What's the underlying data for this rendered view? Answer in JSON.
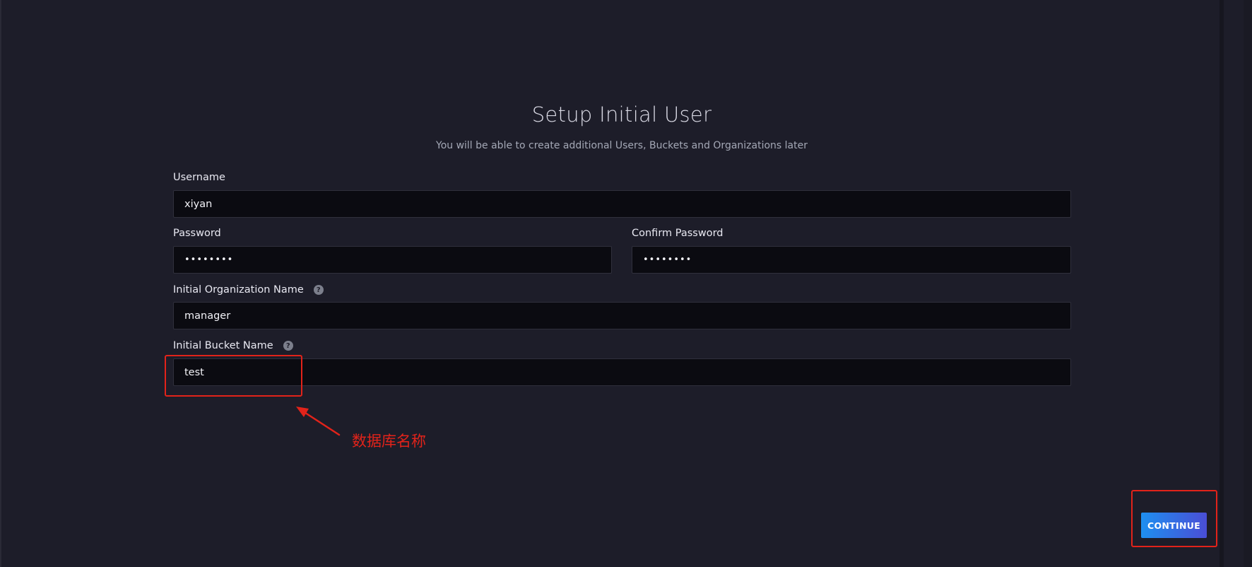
{
  "header": {
    "title": "Setup Initial User",
    "subtitle": "You will be able to create additional Users, Buckets and Organizations later"
  },
  "form": {
    "username": {
      "label": "Username",
      "value": "xiyan"
    },
    "password": {
      "label": "Password",
      "value": "••••••••"
    },
    "confirm_password": {
      "label": "Confirm Password",
      "value": "••••••••"
    },
    "org": {
      "label": "Initial Organization Name",
      "value": "manager",
      "help_icon": "question-icon"
    },
    "bucket": {
      "label": "Initial Bucket Name",
      "value": "test",
      "help_icon": "question-icon"
    }
  },
  "actions": {
    "continue_label": "CONTINUE"
  },
  "annotation": {
    "text": "数据库名称",
    "color": "#e2231a"
  },
  "colors": {
    "background": "#1d1d29",
    "input_bg": "#0b0b11",
    "button_gradient_start": "#1e8ff0",
    "button_gradient_end": "#4a4ed6"
  }
}
